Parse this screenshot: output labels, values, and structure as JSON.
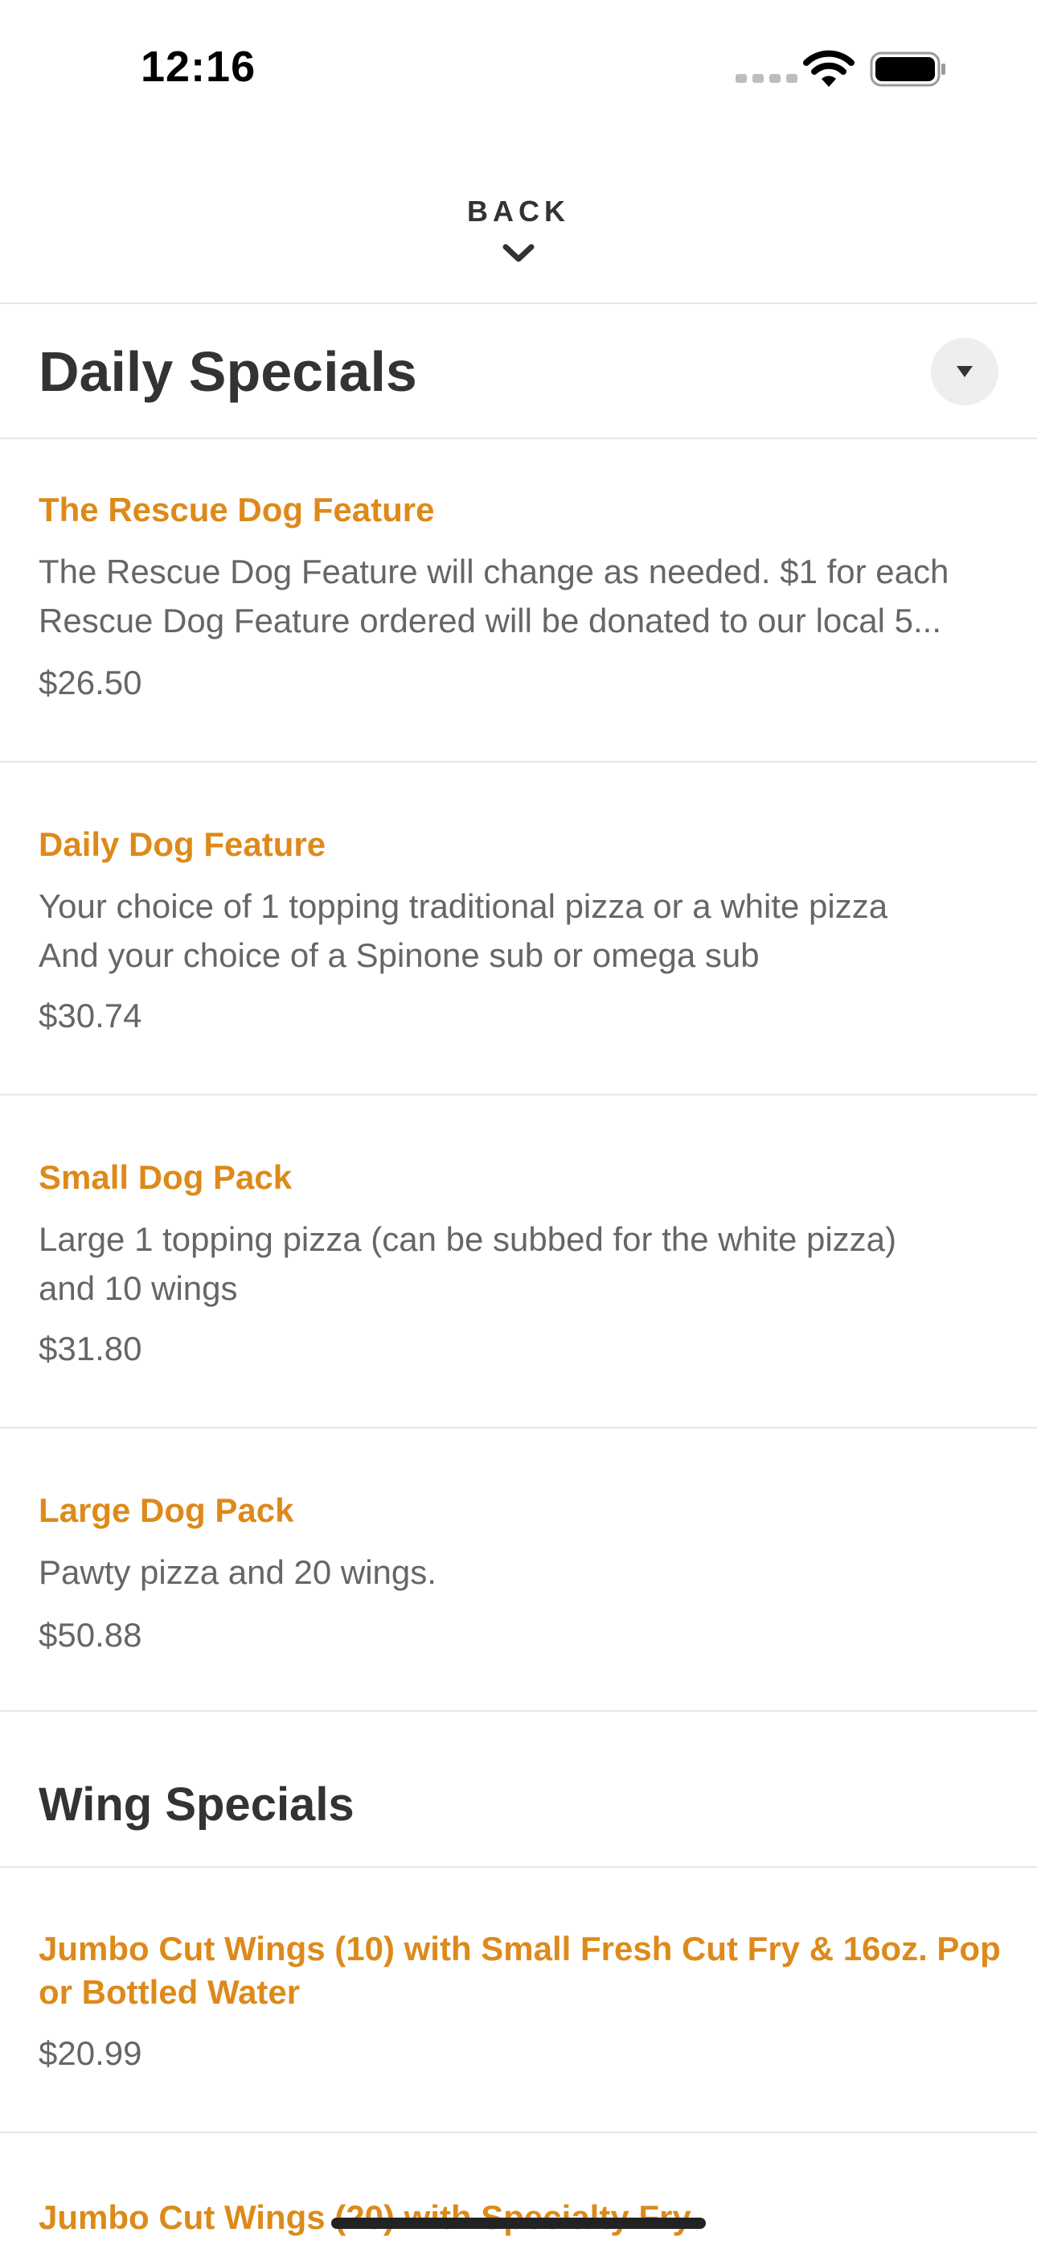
{
  "status_bar": {
    "time": "12:16"
  },
  "nav": {
    "back_label": "BACK"
  },
  "sections": {
    "daily": {
      "title": "Daily Specials",
      "items": [
        {
          "name": "The Rescue Dog Feature",
          "desc_line1": "The Rescue Dog Feature will change as needed. $1 for each",
          "desc_line2": "Rescue Dog Feature ordered will be donated to our local 5...",
          "price": "$26.50"
        },
        {
          "name": "Daily Dog Feature",
          "desc_line1": "Your choice of 1 topping traditional pizza or a white pizza",
          "desc_line2": "And your choice of a Spinone sub or omega sub",
          "price": "$30.74"
        },
        {
          "name": "Small Dog Pack",
          "desc_line1": "Large 1 topping pizza (can be subbed for the white pizza)",
          "desc_line2": "and 10 wings",
          "price": "$31.80"
        },
        {
          "name": "Large Dog Pack",
          "desc_line1": "Pawty pizza and 20 wings.",
          "price": "$50.88"
        }
      ]
    },
    "wing": {
      "title": "Wing Specials",
      "items": [
        {
          "name_line1": "Jumbo Cut Wings (10) with Small Fresh Cut Fry & 16oz. Pop",
          "name_line2": "or Bottled Water",
          "price": "$20.99"
        },
        {
          "name_line1": "Jumbo Cut Wings (20) with Specialty Fry"
        }
      ]
    }
  },
  "icons": {
    "back": "chevron-down-icon",
    "collapse": "caret-down-icon",
    "wifi": "wifi-icon",
    "battery": "battery-icon",
    "signal": "cellular-signal-icon"
  },
  "colors": {
    "item_name": "#dd8a1a",
    "text": "#333333",
    "muted": "#666666",
    "divider": "#e6e6e6"
  }
}
